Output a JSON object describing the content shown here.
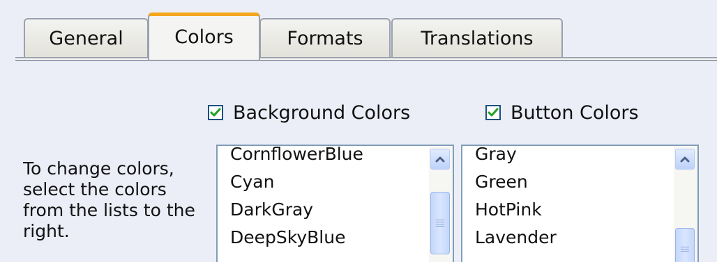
{
  "tabs": [
    {
      "label": "General",
      "active": false
    },
    {
      "label": "Colors",
      "active": true
    },
    {
      "label": "Formats",
      "active": false
    },
    {
      "label": "Translations",
      "active": false
    }
  ],
  "checkboxes": {
    "background": {
      "label": "Background Colors",
      "checked": true
    },
    "button": {
      "label": "Button Colors",
      "checked": true
    }
  },
  "help_text": "To change colors, select the colors from the lists to the right.",
  "background_list": {
    "items": [
      "CornflowerBlue",
      "Cyan",
      "DarkGray",
      "DeepSkyBlue"
    ]
  },
  "button_list": {
    "items": [
      "Gray",
      "Green",
      "HotPink",
      "Lavender"
    ]
  },
  "colors": {
    "active_tab_accent": "#F4A71E",
    "check_mark": "#21A121",
    "window_bg": "#ECEEF7"
  }
}
